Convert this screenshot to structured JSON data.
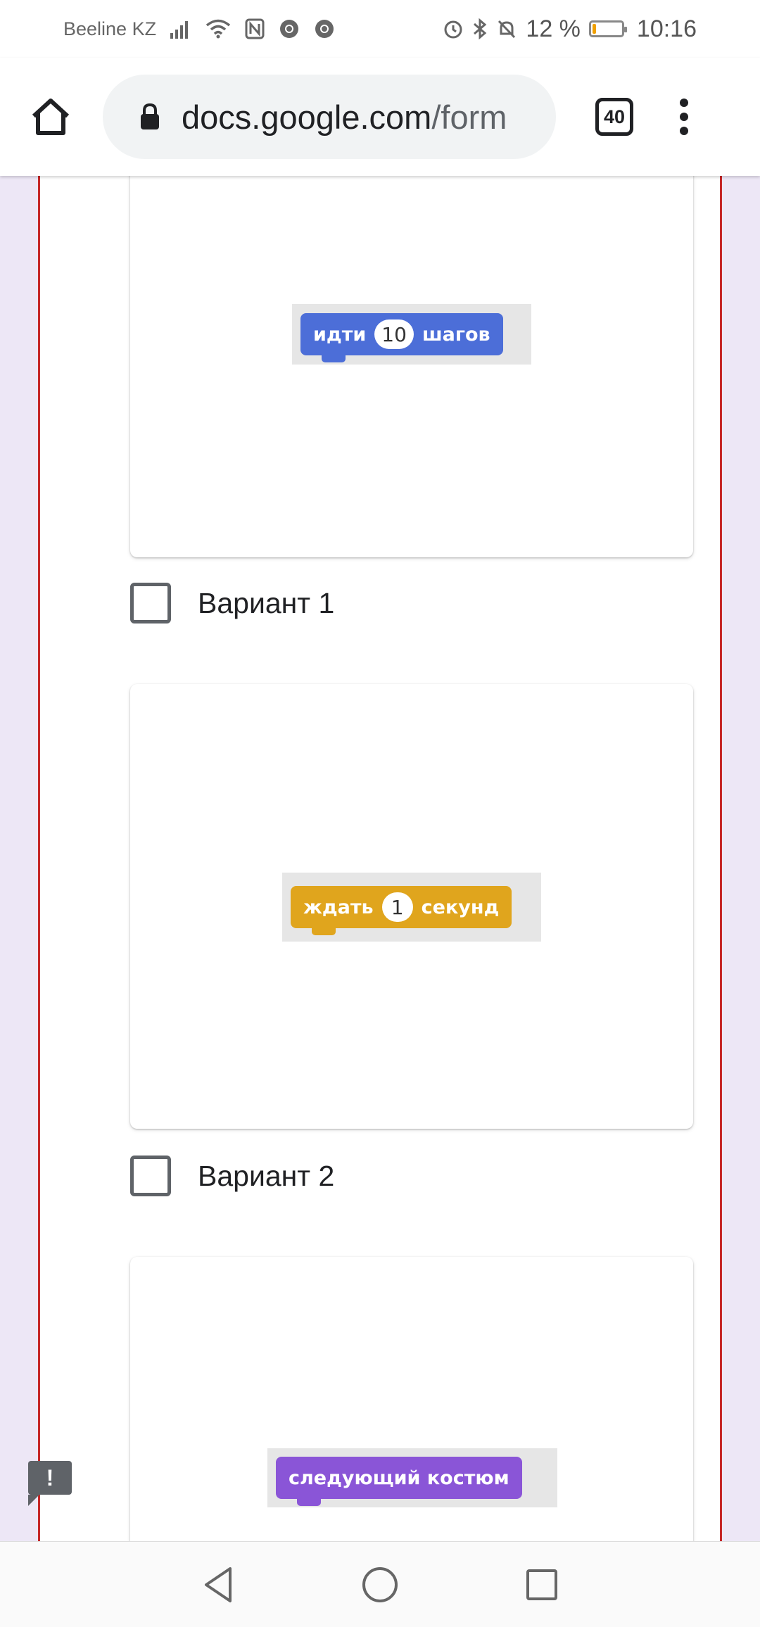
{
  "status_bar": {
    "carrier": "Beeline KZ",
    "battery_percent": "12 %",
    "battery_level": 0.12,
    "time": "10:16",
    "battery_color": "#f0a000"
  },
  "browser": {
    "url_domain": "docs.google.com",
    "url_path": "/form",
    "tab_count": "40"
  },
  "form": {
    "options": [
      {
        "label": "Вариант 1",
        "block": {
          "color": "blue",
          "before": "идти",
          "value": "10",
          "after": "шагов"
        }
      },
      {
        "label": "Вариант 2",
        "block": {
          "color": "gold",
          "before": "ждать",
          "value": "1",
          "after": "секунд"
        }
      },
      {
        "label": "",
        "block": {
          "color": "purple",
          "text": "следующий  костюм"
        }
      }
    ]
  },
  "report_button": {
    "icon": "!"
  },
  "colors": {
    "accent_border": "#c62828",
    "page_background": "#ede7f6",
    "block_blue": "#4c6ed8",
    "block_gold": "#e0a51d",
    "block_purple": "#8a55d7"
  }
}
